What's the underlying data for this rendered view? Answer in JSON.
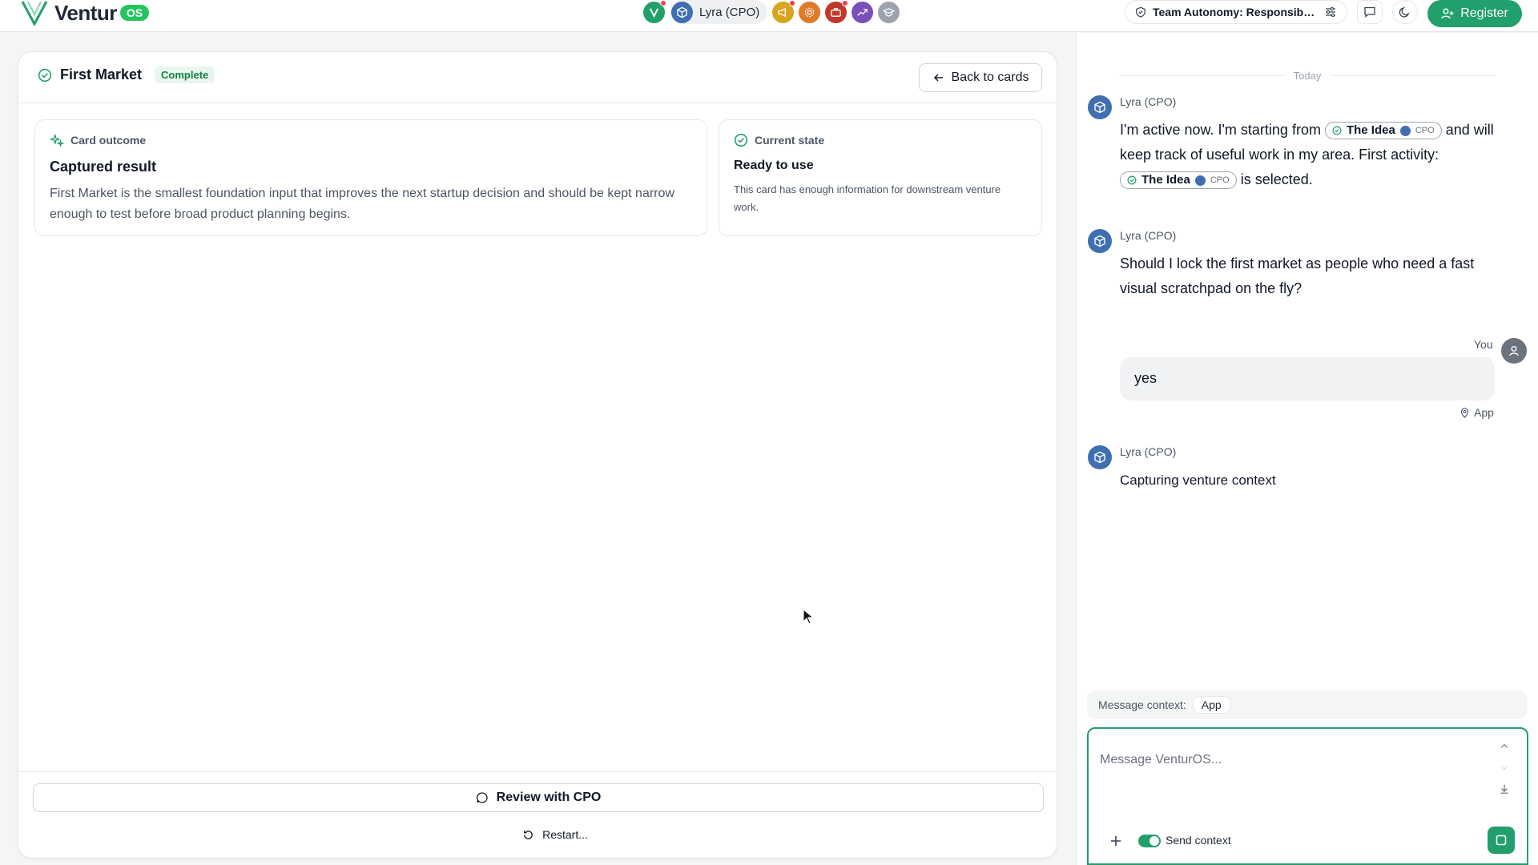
{
  "app": {
    "name": "Ventur",
    "badge": "OS"
  },
  "topbar": {
    "active_agent": "Lyra (CPO)",
    "autonomy_label": "Team Autonomy: Responsible...",
    "register_label": "Register"
  },
  "card": {
    "title": "First Market",
    "status": "Complete",
    "back_label": "Back to cards",
    "outcome": {
      "heading": "Card outcome",
      "title": "Captured result",
      "body": "First Market is the smallest foundation input that improves the next startup decision and should be kept narrow enough to test before broad product planning begins."
    },
    "state": {
      "heading": "Current state",
      "title": "Ready to use",
      "body": "This card has enough information for downstream venture work."
    },
    "review_label": "Review with CPO",
    "restart_label": "Restart..."
  },
  "chat": {
    "day_label": "Today",
    "messages": [
      {
        "author": "Lyra (CPO)",
        "part1": "I'm active now. I'm starting from",
        "chip1": "The Idea",
        "part2": "and will keep track of useful work in my area. First activity:",
        "chip2": "The Idea",
        "part3": "is selected.",
        "chip_tag": "CPO"
      },
      {
        "author": "Lyra (CPO)",
        "text": "Should I lock the first market as people who need a fast visual scratchpad on the fly?"
      },
      {
        "author": "You",
        "text": "yes",
        "context": "App"
      },
      {
        "author": "Lyra (CPO)",
        "text": "Capturing venture context"
      }
    ],
    "context_label": "Message context:",
    "context_value": "App",
    "input_placeholder": "Message VenturOS...",
    "send_context_label": "Send context"
  },
  "colors": {
    "accent": "#22a06b",
    "agent_blue": "#3f6fb0",
    "badge_green_bg": "#e7f7ee"
  },
  "icons": [
    "logo-v-icon",
    "cube-icon",
    "megaphone-icon",
    "gear-icon",
    "briefcase-icon",
    "trending-icon",
    "graduation-icon",
    "shield-check-icon",
    "sliders-icon",
    "chat-icon",
    "moon-icon",
    "user-plus-icon",
    "check-circle-icon",
    "arrow-left-icon",
    "sparkles-icon",
    "message-icon",
    "refresh-icon",
    "map-pin-icon",
    "chevron-up-icon",
    "chevron-down-icon",
    "download-icon",
    "plus-icon",
    "stop-icon"
  ]
}
